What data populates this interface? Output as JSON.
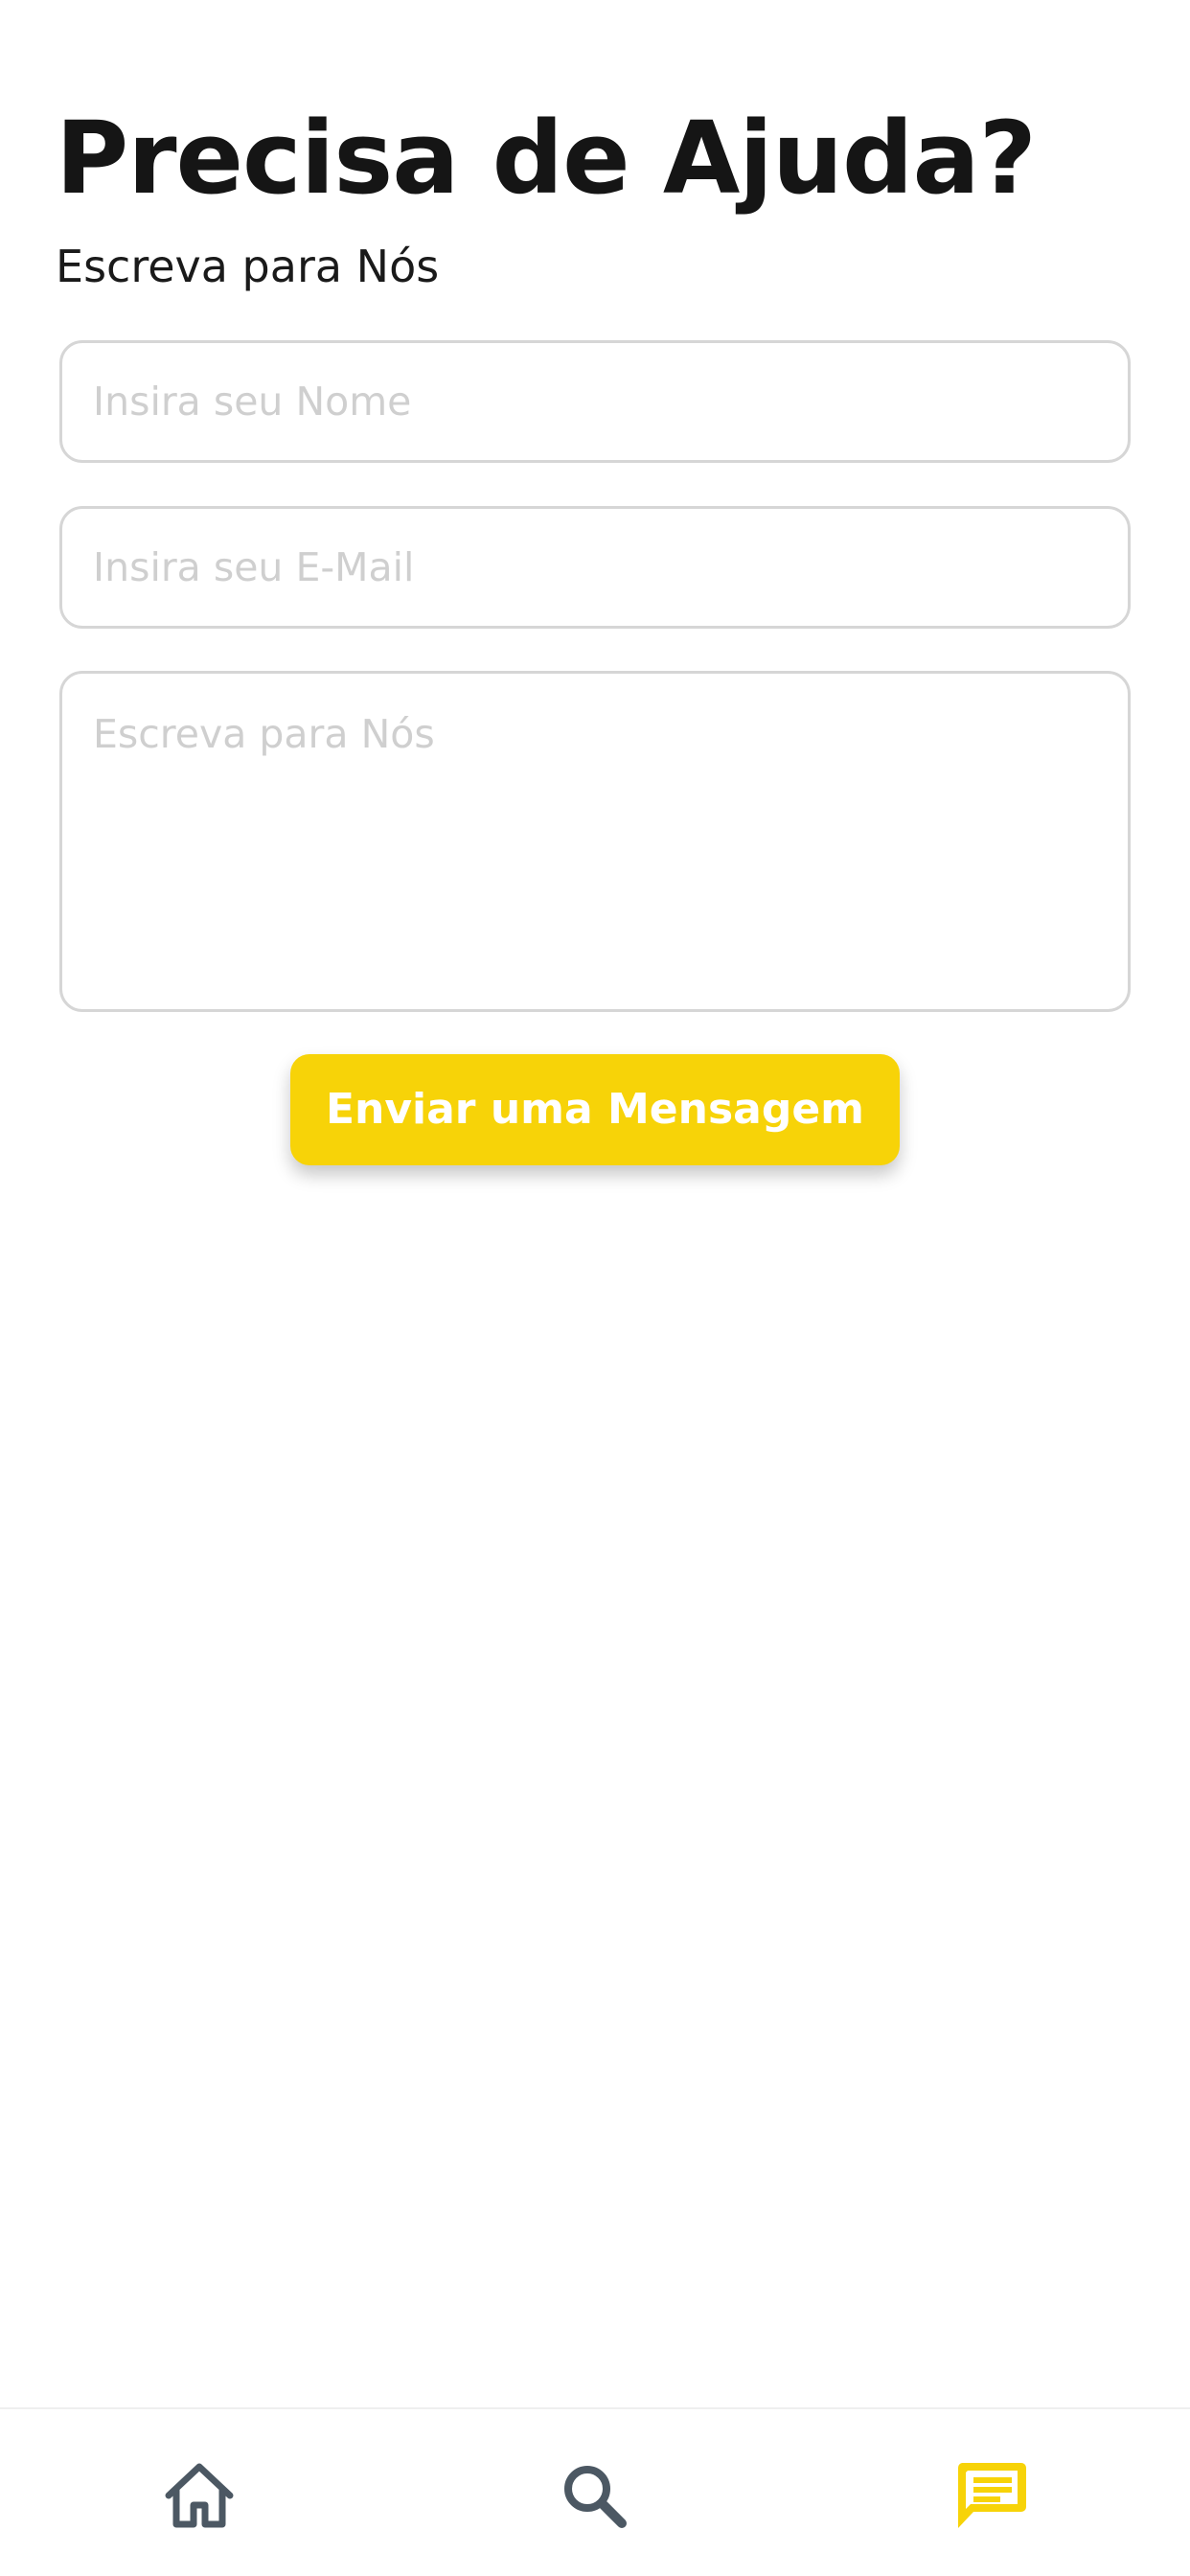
{
  "header": {
    "title": "Precisa de Ajuda?",
    "subtitle": "Escreva para Nós"
  },
  "form": {
    "name_placeholder": "Insira seu Nome",
    "email_placeholder": "Insira seu E-Mail",
    "message_placeholder": "Escreva para Nós",
    "submit_label": "Enviar uma Mensagem"
  },
  "bottom_nav": {
    "items": [
      {
        "icon": "home-icon",
        "active": false
      },
      {
        "icon": "search-icon",
        "active": false
      },
      {
        "icon": "message-icon",
        "active": true
      }
    ]
  },
  "colors": {
    "accent": "#f7d308",
    "inactive_icon": "#4c5863",
    "text": "#151515",
    "placeholder": "#cfcfcf",
    "border": "#d6d6d6"
  }
}
